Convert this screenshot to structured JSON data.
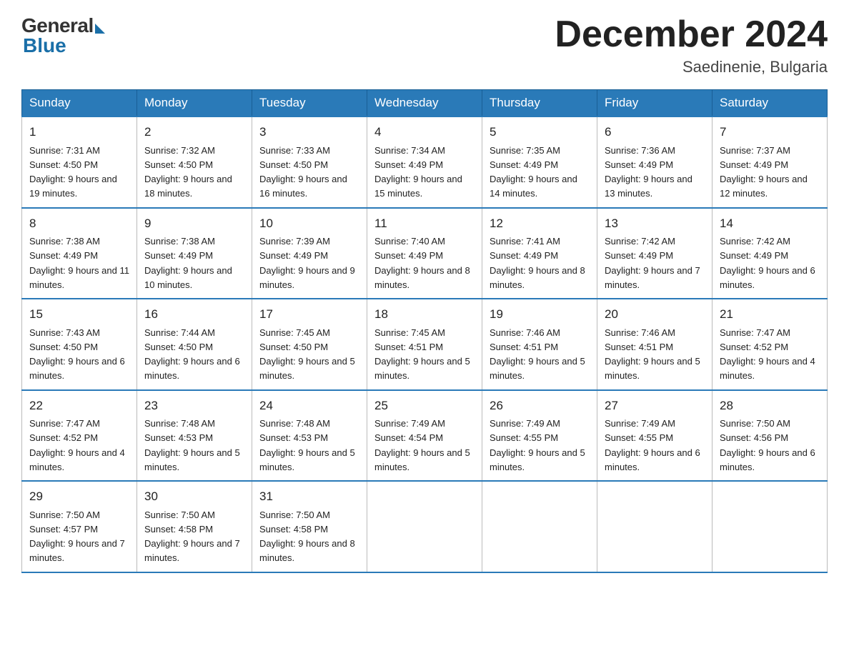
{
  "header": {
    "logo_general": "General",
    "logo_blue": "Blue",
    "month_title": "December 2024",
    "location": "Saedinenie, Bulgaria"
  },
  "days_of_week": [
    "Sunday",
    "Monday",
    "Tuesday",
    "Wednesday",
    "Thursday",
    "Friday",
    "Saturday"
  ],
  "weeks": [
    [
      {
        "day": "1",
        "sunrise": "7:31 AM",
        "sunset": "4:50 PM",
        "daylight": "9 hours and 19 minutes."
      },
      {
        "day": "2",
        "sunrise": "7:32 AM",
        "sunset": "4:50 PM",
        "daylight": "9 hours and 18 minutes."
      },
      {
        "day": "3",
        "sunrise": "7:33 AM",
        "sunset": "4:50 PM",
        "daylight": "9 hours and 16 minutes."
      },
      {
        "day": "4",
        "sunrise": "7:34 AM",
        "sunset": "4:49 PM",
        "daylight": "9 hours and 15 minutes."
      },
      {
        "day": "5",
        "sunrise": "7:35 AM",
        "sunset": "4:49 PM",
        "daylight": "9 hours and 14 minutes."
      },
      {
        "day": "6",
        "sunrise": "7:36 AM",
        "sunset": "4:49 PM",
        "daylight": "9 hours and 13 minutes."
      },
      {
        "day": "7",
        "sunrise": "7:37 AM",
        "sunset": "4:49 PM",
        "daylight": "9 hours and 12 minutes."
      }
    ],
    [
      {
        "day": "8",
        "sunrise": "7:38 AM",
        "sunset": "4:49 PM",
        "daylight": "9 hours and 11 minutes."
      },
      {
        "day": "9",
        "sunrise": "7:38 AM",
        "sunset": "4:49 PM",
        "daylight": "9 hours and 10 minutes."
      },
      {
        "day": "10",
        "sunrise": "7:39 AM",
        "sunset": "4:49 PM",
        "daylight": "9 hours and 9 minutes."
      },
      {
        "day": "11",
        "sunrise": "7:40 AM",
        "sunset": "4:49 PM",
        "daylight": "9 hours and 8 minutes."
      },
      {
        "day": "12",
        "sunrise": "7:41 AM",
        "sunset": "4:49 PM",
        "daylight": "9 hours and 8 minutes."
      },
      {
        "day": "13",
        "sunrise": "7:42 AM",
        "sunset": "4:49 PM",
        "daylight": "9 hours and 7 minutes."
      },
      {
        "day": "14",
        "sunrise": "7:42 AM",
        "sunset": "4:49 PM",
        "daylight": "9 hours and 6 minutes."
      }
    ],
    [
      {
        "day": "15",
        "sunrise": "7:43 AM",
        "sunset": "4:50 PM",
        "daylight": "9 hours and 6 minutes."
      },
      {
        "day": "16",
        "sunrise": "7:44 AM",
        "sunset": "4:50 PM",
        "daylight": "9 hours and 6 minutes."
      },
      {
        "day": "17",
        "sunrise": "7:45 AM",
        "sunset": "4:50 PM",
        "daylight": "9 hours and 5 minutes."
      },
      {
        "day": "18",
        "sunrise": "7:45 AM",
        "sunset": "4:51 PM",
        "daylight": "9 hours and 5 minutes."
      },
      {
        "day": "19",
        "sunrise": "7:46 AM",
        "sunset": "4:51 PM",
        "daylight": "9 hours and 5 minutes."
      },
      {
        "day": "20",
        "sunrise": "7:46 AM",
        "sunset": "4:51 PM",
        "daylight": "9 hours and 5 minutes."
      },
      {
        "day": "21",
        "sunrise": "7:47 AM",
        "sunset": "4:52 PM",
        "daylight": "9 hours and 4 minutes."
      }
    ],
    [
      {
        "day": "22",
        "sunrise": "7:47 AM",
        "sunset": "4:52 PM",
        "daylight": "9 hours and 4 minutes."
      },
      {
        "day": "23",
        "sunrise": "7:48 AM",
        "sunset": "4:53 PM",
        "daylight": "9 hours and 5 minutes."
      },
      {
        "day": "24",
        "sunrise": "7:48 AM",
        "sunset": "4:53 PM",
        "daylight": "9 hours and 5 minutes."
      },
      {
        "day": "25",
        "sunrise": "7:49 AM",
        "sunset": "4:54 PM",
        "daylight": "9 hours and 5 minutes."
      },
      {
        "day": "26",
        "sunrise": "7:49 AM",
        "sunset": "4:55 PM",
        "daylight": "9 hours and 5 minutes."
      },
      {
        "day": "27",
        "sunrise": "7:49 AM",
        "sunset": "4:55 PM",
        "daylight": "9 hours and 6 minutes."
      },
      {
        "day": "28",
        "sunrise": "7:50 AM",
        "sunset": "4:56 PM",
        "daylight": "9 hours and 6 minutes."
      }
    ],
    [
      {
        "day": "29",
        "sunrise": "7:50 AM",
        "sunset": "4:57 PM",
        "daylight": "9 hours and 7 minutes."
      },
      {
        "day": "30",
        "sunrise": "7:50 AM",
        "sunset": "4:58 PM",
        "daylight": "9 hours and 7 minutes."
      },
      {
        "day": "31",
        "sunrise": "7:50 AM",
        "sunset": "4:58 PM",
        "daylight": "9 hours and 8 minutes."
      },
      null,
      null,
      null,
      null
    ]
  ]
}
